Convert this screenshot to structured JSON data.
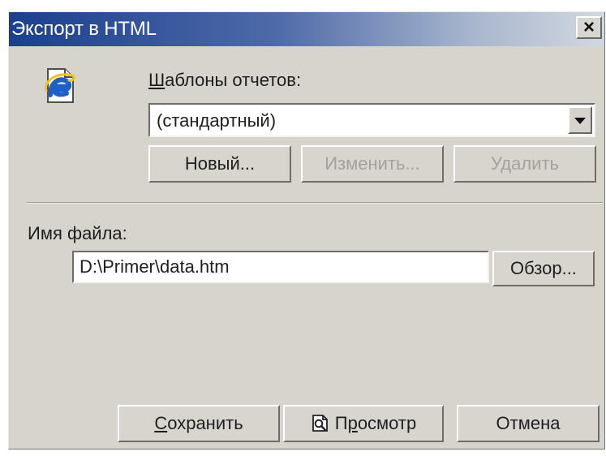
{
  "dialog": {
    "title": "Экспорт в HTML",
    "close_label": "×"
  },
  "icons": {
    "app_icon": "internet-explorer-document-icon",
    "preview_icon": "magnifier-document-icon",
    "dropdown_icon": "chevron-down-icon"
  },
  "templates": {
    "label_prefix": "",
    "label_underlined": "Ш",
    "label_rest": "аблоны отчетов:",
    "selected_value": "(стандартный)",
    "buttons": {
      "new": "Новый...",
      "edit": "Изменить...",
      "delete": "Удалить"
    }
  },
  "file": {
    "label": "Имя файла:",
    "value": "D:\\Primer\\data.htm",
    "browse_label": "Обзор..."
  },
  "actions": {
    "save_prefix": "",
    "save_underlined": "С",
    "save_rest": "охранить",
    "preview_prefix": "П",
    "preview_underlined": "р",
    "preview_rest": "осмотр",
    "cancel": "Отмена"
  },
  "colors": {
    "titlebar_start": "#1b3f8f",
    "titlebar_end": "#d2d8e1",
    "window_face": "#d7d4ce",
    "disabled_text": "#a3a19d"
  }
}
